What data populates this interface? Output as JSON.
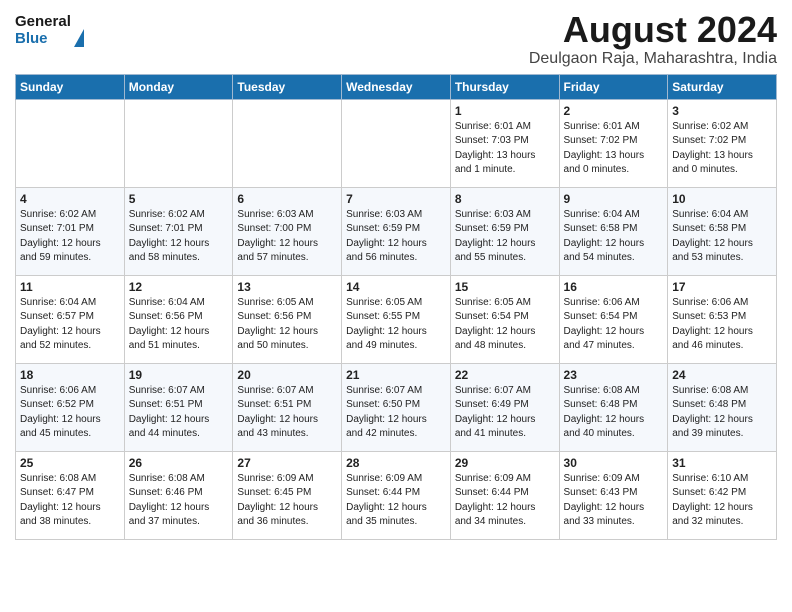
{
  "logo": {
    "general": "General",
    "blue": "Blue"
  },
  "title": "August 2024",
  "subtitle": "Deulgaon Raja, Maharashtra, India",
  "headers": [
    "Sunday",
    "Monday",
    "Tuesday",
    "Wednesday",
    "Thursday",
    "Friday",
    "Saturday"
  ],
  "weeks": [
    [
      {
        "day": "",
        "info": ""
      },
      {
        "day": "",
        "info": ""
      },
      {
        "day": "",
        "info": ""
      },
      {
        "day": "",
        "info": ""
      },
      {
        "day": "1",
        "info": "Sunrise: 6:01 AM\nSunset: 7:03 PM\nDaylight: 13 hours\nand 1 minute."
      },
      {
        "day": "2",
        "info": "Sunrise: 6:01 AM\nSunset: 7:02 PM\nDaylight: 13 hours\nand 0 minutes."
      },
      {
        "day": "3",
        "info": "Sunrise: 6:02 AM\nSunset: 7:02 PM\nDaylight: 13 hours\nand 0 minutes."
      }
    ],
    [
      {
        "day": "4",
        "info": "Sunrise: 6:02 AM\nSunset: 7:01 PM\nDaylight: 12 hours\nand 59 minutes."
      },
      {
        "day": "5",
        "info": "Sunrise: 6:02 AM\nSunset: 7:01 PM\nDaylight: 12 hours\nand 58 minutes."
      },
      {
        "day": "6",
        "info": "Sunrise: 6:03 AM\nSunset: 7:00 PM\nDaylight: 12 hours\nand 57 minutes."
      },
      {
        "day": "7",
        "info": "Sunrise: 6:03 AM\nSunset: 6:59 PM\nDaylight: 12 hours\nand 56 minutes."
      },
      {
        "day": "8",
        "info": "Sunrise: 6:03 AM\nSunset: 6:59 PM\nDaylight: 12 hours\nand 55 minutes."
      },
      {
        "day": "9",
        "info": "Sunrise: 6:04 AM\nSunset: 6:58 PM\nDaylight: 12 hours\nand 54 minutes."
      },
      {
        "day": "10",
        "info": "Sunrise: 6:04 AM\nSunset: 6:58 PM\nDaylight: 12 hours\nand 53 minutes."
      }
    ],
    [
      {
        "day": "11",
        "info": "Sunrise: 6:04 AM\nSunset: 6:57 PM\nDaylight: 12 hours\nand 52 minutes."
      },
      {
        "day": "12",
        "info": "Sunrise: 6:04 AM\nSunset: 6:56 PM\nDaylight: 12 hours\nand 51 minutes."
      },
      {
        "day": "13",
        "info": "Sunrise: 6:05 AM\nSunset: 6:56 PM\nDaylight: 12 hours\nand 50 minutes."
      },
      {
        "day": "14",
        "info": "Sunrise: 6:05 AM\nSunset: 6:55 PM\nDaylight: 12 hours\nand 49 minutes."
      },
      {
        "day": "15",
        "info": "Sunrise: 6:05 AM\nSunset: 6:54 PM\nDaylight: 12 hours\nand 48 minutes."
      },
      {
        "day": "16",
        "info": "Sunrise: 6:06 AM\nSunset: 6:54 PM\nDaylight: 12 hours\nand 47 minutes."
      },
      {
        "day": "17",
        "info": "Sunrise: 6:06 AM\nSunset: 6:53 PM\nDaylight: 12 hours\nand 46 minutes."
      }
    ],
    [
      {
        "day": "18",
        "info": "Sunrise: 6:06 AM\nSunset: 6:52 PM\nDaylight: 12 hours\nand 45 minutes."
      },
      {
        "day": "19",
        "info": "Sunrise: 6:07 AM\nSunset: 6:51 PM\nDaylight: 12 hours\nand 44 minutes."
      },
      {
        "day": "20",
        "info": "Sunrise: 6:07 AM\nSunset: 6:51 PM\nDaylight: 12 hours\nand 43 minutes."
      },
      {
        "day": "21",
        "info": "Sunrise: 6:07 AM\nSunset: 6:50 PM\nDaylight: 12 hours\nand 42 minutes."
      },
      {
        "day": "22",
        "info": "Sunrise: 6:07 AM\nSunset: 6:49 PM\nDaylight: 12 hours\nand 41 minutes."
      },
      {
        "day": "23",
        "info": "Sunrise: 6:08 AM\nSunset: 6:48 PM\nDaylight: 12 hours\nand 40 minutes."
      },
      {
        "day": "24",
        "info": "Sunrise: 6:08 AM\nSunset: 6:48 PM\nDaylight: 12 hours\nand 39 minutes."
      }
    ],
    [
      {
        "day": "25",
        "info": "Sunrise: 6:08 AM\nSunset: 6:47 PM\nDaylight: 12 hours\nand 38 minutes."
      },
      {
        "day": "26",
        "info": "Sunrise: 6:08 AM\nSunset: 6:46 PM\nDaylight: 12 hours\nand 37 minutes."
      },
      {
        "day": "27",
        "info": "Sunrise: 6:09 AM\nSunset: 6:45 PM\nDaylight: 12 hours\nand 36 minutes."
      },
      {
        "day": "28",
        "info": "Sunrise: 6:09 AM\nSunset: 6:44 PM\nDaylight: 12 hours\nand 35 minutes."
      },
      {
        "day": "29",
        "info": "Sunrise: 6:09 AM\nSunset: 6:44 PM\nDaylight: 12 hours\nand 34 minutes."
      },
      {
        "day": "30",
        "info": "Sunrise: 6:09 AM\nSunset: 6:43 PM\nDaylight: 12 hours\nand 33 minutes."
      },
      {
        "day": "31",
        "info": "Sunrise: 6:10 AM\nSunset: 6:42 PM\nDaylight: 12 hours\nand 32 minutes."
      }
    ]
  ]
}
